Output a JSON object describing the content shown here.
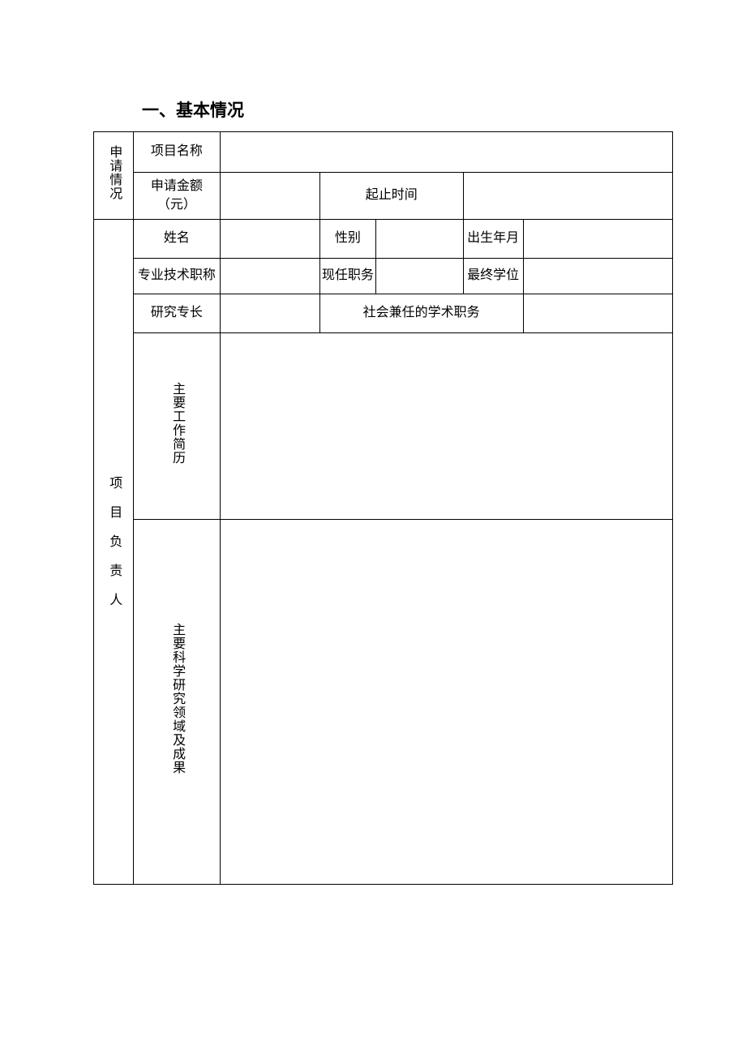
{
  "title": "一、基本情况",
  "section_application": {
    "header": "申请情况",
    "project_name_label": "项目名称",
    "project_name_value": "",
    "amount_label": "申请金额（元）",
    "amount_value": "",
    "period_label": "起止时间",
    "period_value": ""
  },
  "section_leader": {
    "header": "项目负责人",
    "name_label": "姓名",
    "name_value": "",
    "gender_label": "性别",
    "gender_value": "",
    "birth_label": "出生年月",
    "birth_value": "",
    "proftitle_label": "专业技术职称",
    "proftitle_value": "",
    "position_label": "现任职务",
    "position_value": "",
    "degree_label": "最终学位",
    "degree_value": "",
    "specialty_label": "研究专长",
    "specialty_value": "",
    "academic_duty_label": "社会兼任的学术职务",
    "academic_duty_value": "",
    "work_history_label": "主要工作简历",
    "work_history_value": "",
    "research_label": "主要科学研究领域及成果",
    "research_value": ""
  }
}
